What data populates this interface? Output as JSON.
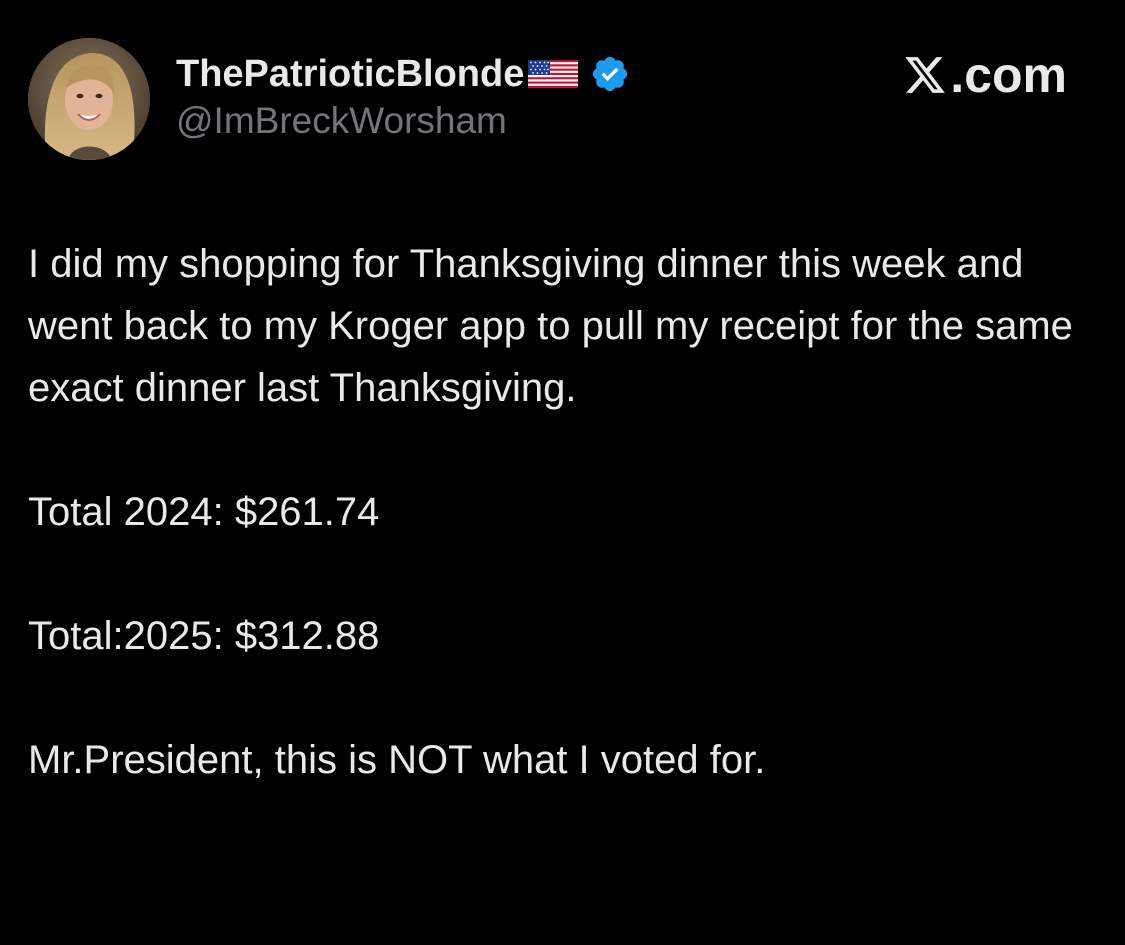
{
  "tweet": {
    "author": {
      "display_name": "ThePatrioticBlonde",
      "flag_icon": "us-flag-icon",
      "verified_icon": "verified-badge-icon",
      "verified_color": "#1d9bf0",
      "handle": "@ImBreckWorsham"
    },
    "brand": {
      "logo_icon": "x-logo-icon",
      "text": ".com"
    },
    "body": {
      "paragraph_1": "I did my shopping for Thanksgiving dinner this week and went back to my Kroger app to pull my receipt for the same exact dinner last Thanksgiving.",
      "paragraph_2": "Total 2024: $261.74",
      "paragraph_3": "Total:2025: $312.88",
      "paragraph_4": "Mr.President, this is NOT what I voted for."
    }
  },
  "colors": {
    "background": "#000000",
    "primary_text": "#e7e9ea",
    "secondary_text": "#71767b"
  }
}
